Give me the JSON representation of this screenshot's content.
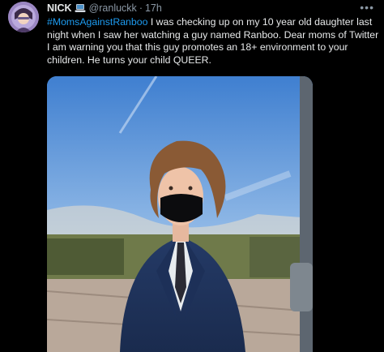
{
  "tweet": {
    "author_name": "NICK",
    "handle": "@ranluckk",
    "separator": "·",
    "time": "17h",
    "more_label": "•••",
    "hashtag": "#MomsAgainstRanboo",
    "body": " I was checking up on my 10 year old daughter last night when I saw her watching a guy named Ranboo. Dear moms of Twitter I am warning you that this guy promotes an 18+ environment to your children. He turns your child QUEER."
  },
  "colors": {
    "background": "#000000",
    "text": "#e7e9ea",
    "muted": "#8b98a5",
    "link": "#1d9bf0"
  }
}
